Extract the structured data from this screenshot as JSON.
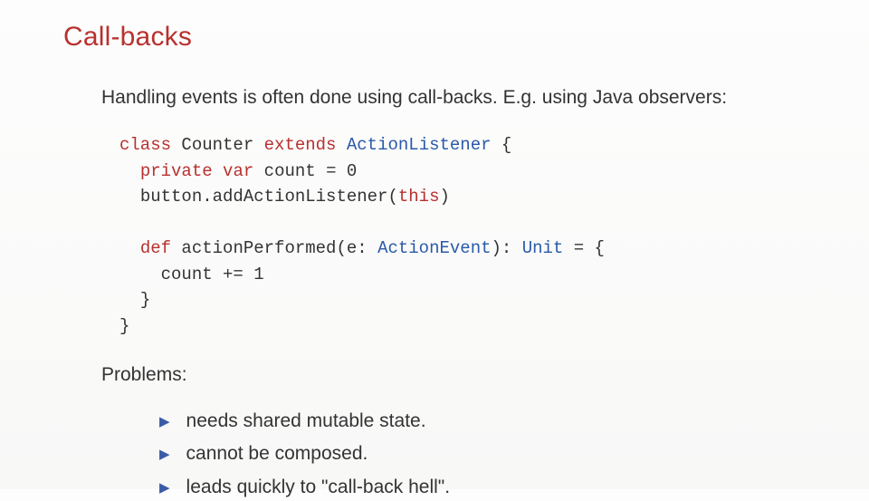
{
  "title": "Call-backs",
  "intro": "Handling events is often done using call-backs. E.g. using Java observers:",
  "code": {
    "line1": {
      "kw1": "class",
      "t1": " Counter ",
      "kw2": "extends",
      "t2": " ",
      "type1": "ActionListener",
      "t3": " {"
    },
    "line2": {
      "kw1": "private",
      "t1": " ",
      "kw2": "var",
      "t2": " count = 0"
    },
    "line3": {
      "t1": "button.addActionListener(",
      "kw1": "this",
      "t2": ")"
    },
    "line4": {
      "kw1": "def",
      "t1": " actionPerformed(e: ",
      "type1": "ActionEvent",
      "t2": "): ",
      "type2": "Unit",
      "t3": " = {"
    },
    "line5": {
      "t1": "count += 1"
    },
    "line6": {
      "t1": "}"
    },
    "line7": {
      "t1": "}"
    }
  },
  "problems_label": "Problems:",
  "bullets": {
    "b1": "needs shared mutable state.",
    "b2": "cannot be composed.",
    "b3": "leads quickly to \"call-back hell\"."
  },
  "bullet_marker": "▶"
}
